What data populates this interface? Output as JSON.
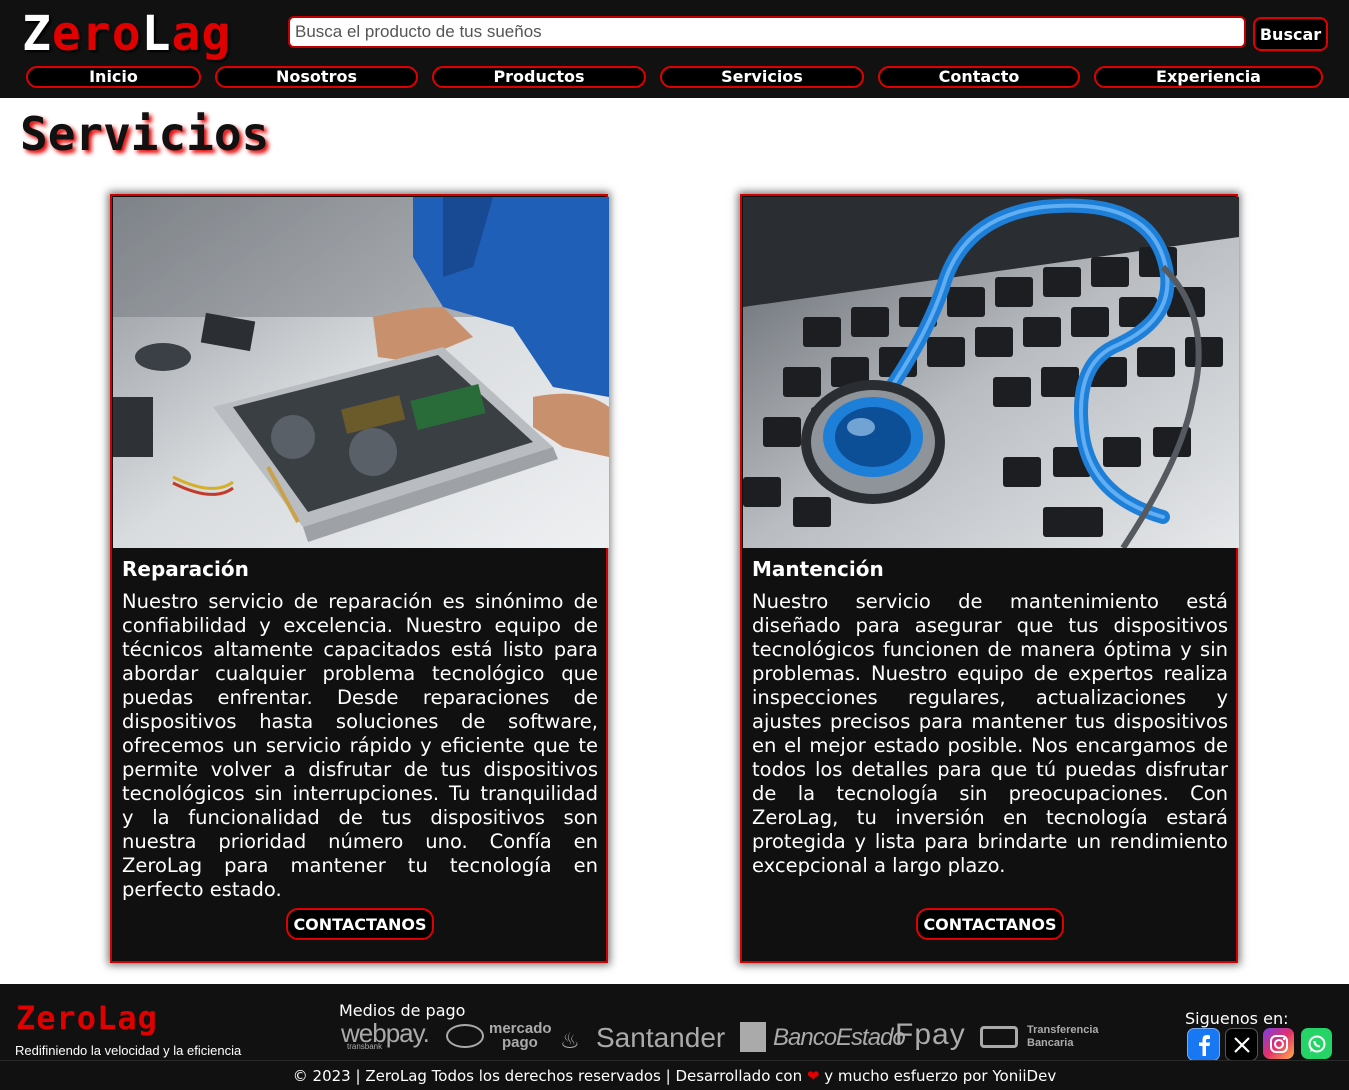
{
  "header": {
    "logo_part1": "Z",
    "logo_part2": "ero",
    "logo_part3": "L",
    "logo_part4": "ag",
    "search_placeholder": "Busca el producto de tus sueños",
    "search_button": "Buscar",
    "nav": [
      "Inicio",
      "Nosotros",
      "Productos",
      "Servicios",
      "Contacto",
      "Experiencia"
    ]
  },
  "main": {
    "title": "Servicios",
    "cards": [
      {
        "image_icon": "laptop-repair-photo",
        "title": "Reparación",
        "text": "Nuestro servicio de reparación es sinónimo de confiabilidad y excelencia. Nuestro equipo de técnicos altamente capacitados está listo para abordar cualquier problema tecnológico que puedas enfrentar. Desde reparaciones de dispositivos hasta soluciones de software, ofrecemos un servicio rápido y eficiente que te permite volver a disfrutar de tus dispositivos tecnológicos sin interrupciones. Tu tranquilidad y la funcionalidad de tus dispositivos son nuestra prioridad número uno. Confía en ZeroLag para mantener tu tecnología en perfecto estado.",
        "button": "CONTACTANOS"
      },
      {
        "image_icon": "stethoscope-keyboard-photo",
        "title": "Mantención",
        "text": "Nuestro servicio de mantenimiento está diseñado para asegurar que tus dispositivos tecnológicos funcionen de manera óptima y sin problemas. Nuestro equipo de expertos realiza inspecciones regulares, actualizaciones y ajustes precisos para mantener tus dispositivos en el mejor estado posible. Nos encargamos de todos los detalles para que tú puedas disfrutar de la tecnología sin preocupaciones. Con ZeroLag, tu inversión en tecnología estará protegida y lista para brindarte un rendimiento excepcional a largo plazo.",
        "button": "CONTACTANOS"
      }
    ]
  },
  "footer": {
    "logo": "ZeroLag",
    "tagline": "Redifiniendo la velocidad y la eficiencia",
    "payments_title": "Medios de pago",
    "payments": [
      "webpay.",
      "transbank",
      "mercado",
      "pago",
      "Santander",
      "BancoEstado",
      "Fpay",
      "Transferencia",
      "Bancaria"
    ],
    "follow_title": "Siguenos en:",
    "social": [
      "facebook-icon",
      "x-icon",
      "instagram-icon",
      "whatsapp-icon"
    ],
    "copyright_before": "© 2023 | ZeroLag Todos los derechos reservados | Desarrollado con",
    "copyright_after": "y mucho esfuerzo por YoniiDev",
    "accent": "#e00000",
    "background": "#111111"
  }
}
